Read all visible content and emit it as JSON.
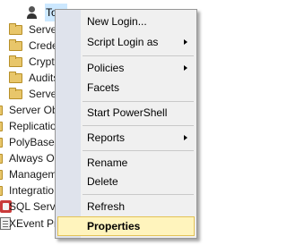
{
  "object_explorer": {
    "rows": [
      {
        "label": "Tom",
        "icon": "user-icon",
        "selected": true
      },
      {
        "label": "Server",
        "icon": "folder-icon"
      },
      {
        "label": "Crede",
        "icon": "folder-icon"
      },
      {
        "label": "Crypto",
        "icon": "folder-icon"
      },
      {
        "label": "Audits",
        "icon": "folder-icon"
      },
      {
        "label": "Server",
        "icon": "folder-icon"
      },
      {
        "label": "Server Ob",
        "icon": "folder-icon"
      },
      {
        "label": "Replicatio",
        "icon": "folder-icon"
      },
      {
        "label": "PolyBase",
        "icon": "folder-icon"
      },
      {
        "label": "Always On",
        "icon": "folder-icon"
      },
      {
        "label": "Managem",
        "icon": "folder-icon"
      },
      {
        "label": "Integratio",
        "icon": "folder-icon"
      },
      {
        "label": "SQL Serve",
        "icon": "sql-agent-icon"
      },
      {
        "label": "XEvent Pr",
        "icon": "xevent-profiler-icon"
      }
    ]
  },
  "context_menu": {
    "items": [
      {
        "label": "New Login...",
        "has_submenu": false
      },
      {
        "label": "Script Login as",
        "has_submenu": true
      },
      {
        "label": "Policies",
        "has_submenu": true
      },
      {
        "label": "Facets",
        "has_submenu": false
      },
      {
        "label": "Start PowerShell",
        "has_submenu": false
      },
      {
        "label": "Reports",
        "has_submenu": true
      },
      {
        "label": "Rename",
        "has_submenu": false
      },
      {
        "label": "Delete",
        "has_submenu": false
      },
      {
        "label": "Refresh",
        "has_submenu": false
      },
      {
        "label": "Properties",
        "has_submenu": false,
        "highlighted": true
      }
    ]
  },
  "colors": {
    "menu_background": "#f0f0f0",
    "menu_gutter": "#dfe3ec",
    "highlight_background": "#fff4bd",
    "highlight_border": "#e3c256",
    "selection_background": "#cce8ff"
  }
}
